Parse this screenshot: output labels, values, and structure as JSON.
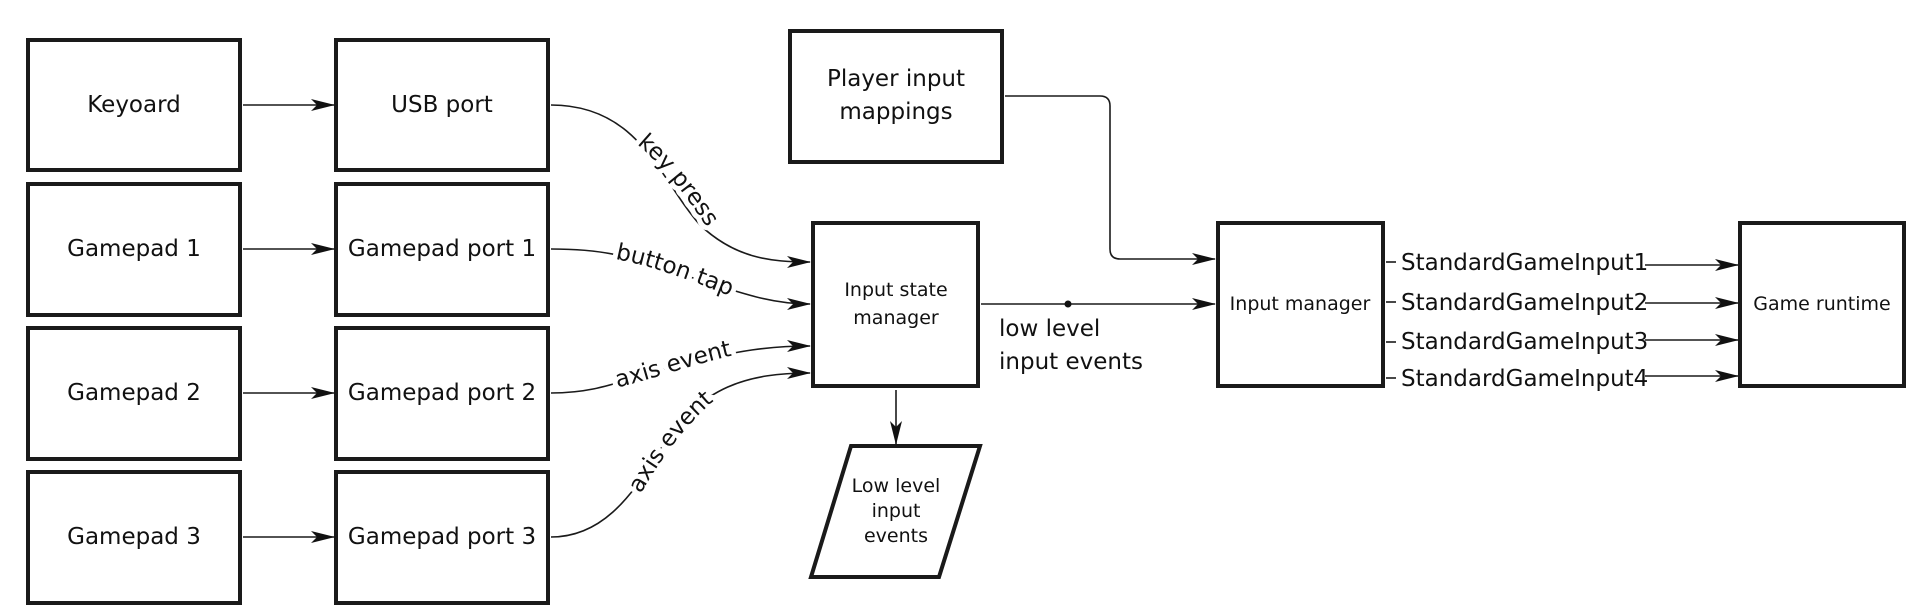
{
  "nodes": {
    "keyboard": {
      "label": "Keyoard"
    },
    "gamepad1": {
      "label": "Gamepad 1"
    },
    "gamepad2": {
      "label": "Gamepad 2"
    },
    "gamepad3": {
      "label": "Gamepad 3"
    },
    "usb_port": {
      "label": "USB port"
    },
    "gamepad_port1": {
      "label": "Gamepad port 1"
    },
    "gamepad_port2": {
      "label": "Gamepad port 2"
    },
    "gamepad_port3": {
      "label": "Gamepad port 3"
    },
    "input_state_manager": {
      "lines": [
        "Input state",
        "manager"
      ]
    },
    "low_level_events_store": {
      "lines": [
        "Low level",
        "input",
        "events"
      ]
    },
    "player_input_mappings": {
      "lines": [
        "Player input",
        "mappings"
      ]
    },
    "input_manager": {
      "label": "Input manager"
    },
    "game_runtime": {
      "label": "Game runtime"
    }
  },
  "edges": {
    "usb_to_ism": {
      "label": "key press"
    },
    "port1_to_ism": {
      "label": "button tap"
    },
    "port2_to_ism": {
      "label": "axis event"
    },
    "port3_to_ism": {
      "label": "axis event"
    },
    "ism_to_im": {
      "lines": [
        "low level",
        "input events"
      ]
    },
    "im_to_runtime": [
      {
        "label": "StandardGameInput1"
      },
      {
        "label": "StandardGameInput2"
      },
      {
        "label": "StandardGameInput3"
      },
      {
        "label": "StandardGameInput4"
      }
    ]
  }
}
